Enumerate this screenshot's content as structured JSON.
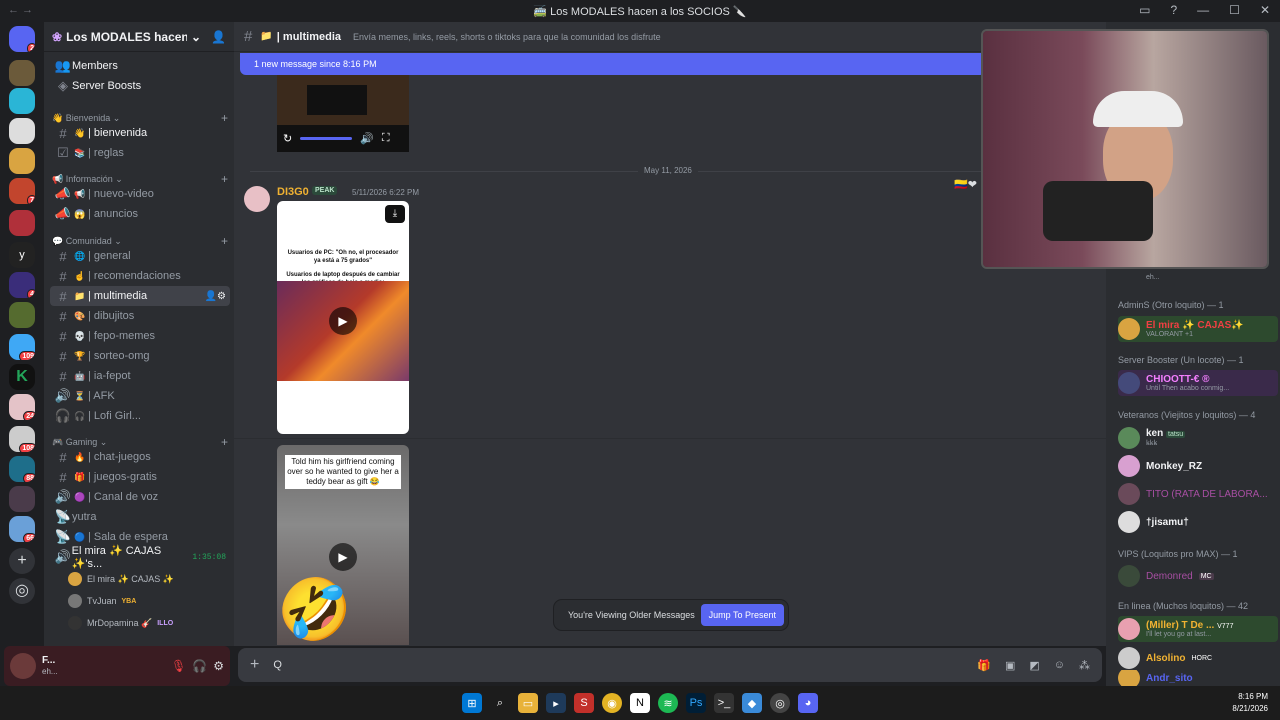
{
  "window": {
    "title": "🚎 Los MODALES hacen a los SOCIOS 🔪"
  },
  "server": {
    "name": "Los MODALES hacen a l..."
  },
  "sidebar": {
    "top_items": [
      {
        "label": "Members"
      },
      {
        "label": "Server Boosts"
      }
    ],
    "categories": [
      {
        "label": "Bienvenida"
      },
      {
        "label": "Información"
      },
      {
        "label": "Comunidad"
      },
      {
        "label": "Gaming"
      }
    ],
    "channels": [
      {
        "label": "| bienvenida"
      },
      {
        "label": "| reglas"
      },
      {
        "label": "| nuevo-video"
      },
      {
        "label": "| anuncios"
      },
      {
        "label": "| general"
      },
      {
        "label": "| recomendaciones"
      },
      {
        "label": "| multimedia"
      },
      {
        "label": "| dibujitos"
      },
      {
        "label": "| fepo-memes"
      },
      {
        "label": "| sorteo-omg"
      },
      {
        "label": "| ia-fepot"
      },
      {
        "label": "| AFK"
      },
      {
        "label": "| Lofi Girl..."
      },
      {
        "label": "| chat-juegos"
      },
      {
        "label": "| juegos-gratis"
      },
      {
        "label": "| Canal de voz"
      },
      {
        "label": "yutra"
      },
      {
        "label": "| Sala de espera"
      },
      {
        "label": "El mira ✨ CAJAS ✨'s..."
      }
    ],
    "voice_timer": "1:35:08",
    "voice_users": [
      {
        "name": "El mira ✨ CAJAS ✨"
      },
      {
        "name": "TvJuan",
        "tag": "YBA"
      },
      {
        "name": "MrDopamina 🎸",
        "tag": "ILLO"
      }
    ]
  },
  "user_panel": {
    "name": "F...",
    "status": "eh..."
  },
  "chat": {
    "channel_name": "| multimedia",
    "topic": "Envía memes, links, reels, shorts o tiktoks para que la comunidad los disfrute",
    "new_message_banner": "1 new message since 8:16 PM",
    "date_divider": "May 11, 2026",
    "message": {
      "author": "DI3G0",
      "tag": "PEAK",
      "timestamp": "5/11/2026 6:22 PM",
      "video1_caption_a": "Usuarios de PC: \"Oh no, el procesador ya está a 75 grados\"",
      "video1_caption_b": "Usuarios de laptop después de cambiar los gráficos de bajo a medio:",
      "video2_caption": "Told him his girlfriend coming over so he wanted to give her a teddy bear as gift 😂"
    },
    "viewing_older": "You're Viewing Older Messages",
    "jump_button": "Jump To Present",
    "composer_value": "Q"
  },
  "members": {
    "groups": [
      {
        "label": "AdminS (Otro loquito) — 1",
        "members": [
          {
            "name": "El mira ✨ CAJAS✨",
            "sub": "VALORANT +1",
            "color": "#f23f43"
          }
        ]
      },
      {
        "label": "Server Booster (Un locote) — 1",
        "members": [
          {
            "name": "CHIOOTT-€ ®",
            "sub": "Until Then acabo conmig...",
            "color": "#f47fff"
          }
        ]
      },
      {
        "label": "Veteranos (Viejitos y loquitos) — 4",
        "members": [
          {
            "name": "ken",
            "tag": "tatsu",
            "sub": "ꝃꝃꝃ",
            "color": "#f2f3f5"
          },
          {
            "name": "Monkey_RZ",
            "sub": "",
            "color": "#f2f3f5"
          },
          {
            "name": "TITO (RATA DE LABORA...",
            "sub": "",
            "color": "#a74ea2"
          },
          {
            "name": "†jisamu†",
            "sub": "",
            "color": "#f2f3f5"
          }
        ]
      },
      {
        "label": "VIPS (Loquitos pro MAX) — 1",
        "members": [
          {
            "name": "Demonred",
            "tag": "MC",
            "sub": "",
            "color": "#a74ea2"
          }
        ]
      },
      {
        "label": "En linea (Muchos loquitos) — 42",
        "members": [
          {
            "name": "(Miller) T De ...",
            "tag": "V777",
            "sub": "I'll let you go at last...",
            "color": "#f0b232"
          },
          {
            "name": "Alsolino",
            "tag": "HORC",
            "sub": "",
            "color": "#f0b232"
          },
          {
            "name": "Andr_sito",
            "sub": "",
            "color": "#5865f2"
          }
        ]
      }
    ],
    "partial_top": "eh..."
  },
  "taskbar": {
    "time": "8:16 PM",
    "date": "8/21/2026"
  },
  "colors": {
    "accent": "#5865f2",
    "bg": "#313338",
    "sidebar": "#2b2d31"
  }
}
